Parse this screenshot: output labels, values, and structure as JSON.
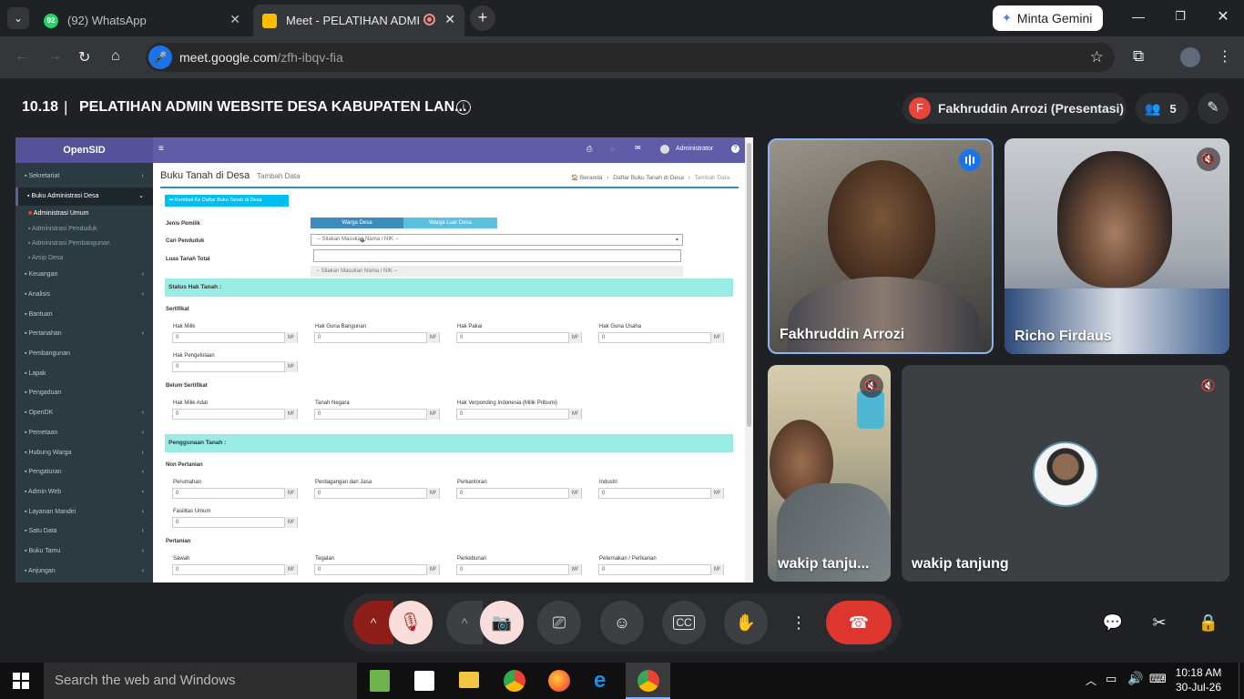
{
  "tabs": [
    {
      "label": "(92) WhatsApp",
      "badge": "92"
    },
    {
      "label": "Meet - PELATIHAN ADMIN"
    }
  ],
  "gemini_button": "Minta Gemini",
  "address": {
    "host": "meet.google.com",
    "path": "/zfh-ibqv-fia"
  },
  "meeting": {
    "time": "10.18",
    "separator": "|",
    "title": "PELATIHAN ADMIN WEBSITE DESA KABUPATEN LAN...",
    "presenter_initial": "F",
    "presenter": "Fakhruddin Arrozi (Presentasi)",
    "participant_count": "5"
  },
  "participants": [
    {
      "name": "Fakhruddin Arrozi",
      "speaking": true
    },
    {
      "name": "Richo Firdaus",
      "muted": true
    },
    {
      "name": "wakip tanju...",
      "muted": true
    },
    {
      "name": "wakip tanjung",
      "muted": true
    }
  ],
  "shared": {
    "brand": "OpenSID",
    "admin": "Administrator",
    "sidebar": [
      {
        "label": "Sekretariat",
        "arrow": "‹"
      },
      {
        "label": "Buku Administrasi Desa",
        "arrow": "⌄",
        "active": true
      },
      {
        "label": "Administrasi Umum",
        "sub": true,
        "current": true
      },
      {
        "label": "Administrasi Penduduk",
        "sub": true
      },
      {
        "label": "Administrasi Pembangunan",
        "sub": true
      },
      {
        "label": "Arsip Desa",
        "sub": true
      },
      {
        "label": "Keuangan",
        "arrow": "‹"
      },
      {
        "label": "Analisis",
        "arrow": "‹"
      },
      {
        "label": "Bantuan"
      },
      {
        "label": "Pertanahan",
        "arrow": "‹"
      },
      {
        "label": "Pembangunan"
      },
      {
        "label": "Lapak"
      },
      {
        "label": "Pengaduan"
      },
      {
        "label": "OpenDK",
        "arrow": "‹"
      },
      {
        "label": "Pemetaan",
        "arrow": "‹"
      },
      {
        "label": "Hubung Warga",
        "arrow": "‹"
      },
      {
        "label": "Pengaturan",
        "arrow": "‹"
      },
      {
        "label": "Admin Web",
        "arrow": "‹"
      },
      {
        "label": "Layanan Mandiri",
        "arrow": "‹"
      },
      {
        "label": "Satu Data",
        "arrow": "‹"
      },
      {
        "label": "Buku Tamu",
        "arrow": "‹"
      },
      {
        "label": "Anjungan",
        "arrow": "‹"
      }
    ],
    "page_title": "Buku Tanah di Desa",
    "page_subtitle": "Tambah Data",
    "breadcrumb": {
      "home": "Beranda",
      "list": "Daftar Buku Tanah di Desa",
      "current": "Tambah Data",
      "sep": "›"
    },
    "back_button": "Kembali Ke Daftar Buku Tanah di Desa",
    "jenis_pemilik": "Jenis Pemilik",
    "toggle_a": "Warga Desa",
    "toggle_b": "Warga Luar Desa",
    "cari_penduduk": "Cari Penduduk",
    "select_placeholder": "-- Silakan Masukan Nama / NIK --",
    "dropdown_option": "-- Silakan Masukan Nama / NIK --",
    "luas_tanah": "Luas Tanah Total",
    "status_band": "Status Hak Tanah :",
    "sertifikat": "Sertifikat",
    "hak_milik": "Hak Milik",
    "hak_guna_bangunan": "Hak Guna Bangunan",
    "hak_pakai": "Hak Pakai",
    "hak_guna_usaha": "Hak Guna Usaha",
    "hak_pengelolaan": "Hak Pengelolaan",
    "belum_sertifikat": "Belum Sertifikat",
    "hak_milik_adat": "Hak Milik Adat",
    "tanah_negara": "Tanah Negara",
    "hak_verponding": "Hak Verponding Indonesia (Milik Pribumi)",
    "penggunaan_band": "Penggunaan Tanah :",
    "non_pertanian": "Non Pertanian",
    "perumahan": "Perumahan",
    "perdagangan": "Perdagangan dan Jasa",
    "perkantoran": "Perkantoran",
    "industri": "Industri",
    "fasilitas_umum": "Fasilitas Umum",
    "pertanian": "Pertanian",
    "sawah": "Sawah",
    "tegalan": "Tegalan",
    "perkebunan": "Perkebunan",
    "peternakan": "Peternakan / Perikanan",
    "zero": "0",
    "unit": "M²"
  },
  "taskbar": {
    "search": "Search the web and Windows",
    "time": "10:18 AM",
    "date": "30-Jul-26"
  },
  "colors": {
    "accent_blue": "#8ab4f8",
    "end_call": "#ea4335",
    "muted_pink": "#f9dedc",
    "opensid_purple": "#605ca8"
  }
}
